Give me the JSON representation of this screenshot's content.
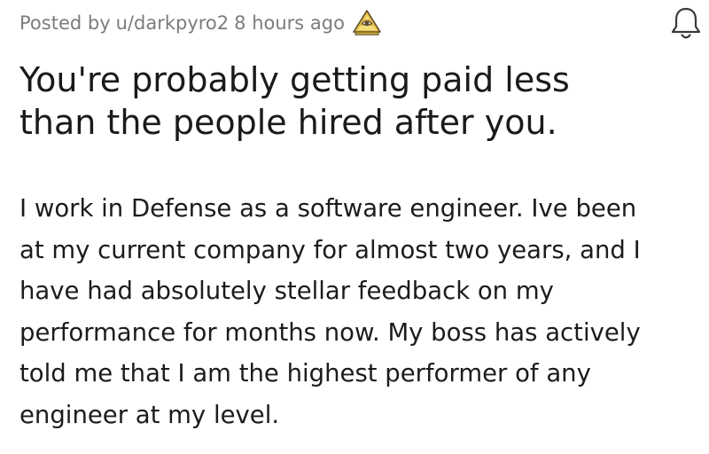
{
  "post": {
    "meta": {
      "prefix": "Posted by",
      "username": "u/darkpyro2",
      "time": "8 hours ago",
      "award_icon": "illuminati-award-icon"
    },
    "notification_icon": "bell-icon",
    "title_lines": [
      "You're probably getting paid less",
      "than the people hired after you."
    ],
    "body_lines": [
      "I work in Defense as a software engineer. Ive been",
      "at my current company for almost two years, and I",
      "have had absolutely stellar feedback on my",
      "performance for months now. My boss has actively",
      "told me that I am the highest performer of any",
      "engineer at my level."
    ]
  },
  "colors": {
    "meta_text": "#7c7c7c",
    "title_text": "#1a1a1b",
    "body_text": "#1c1c1c",
    "award_gold": "#e8c547",
    "award_outline": "#5a4a2a",
    "background": "#ffffff"
  }
}
